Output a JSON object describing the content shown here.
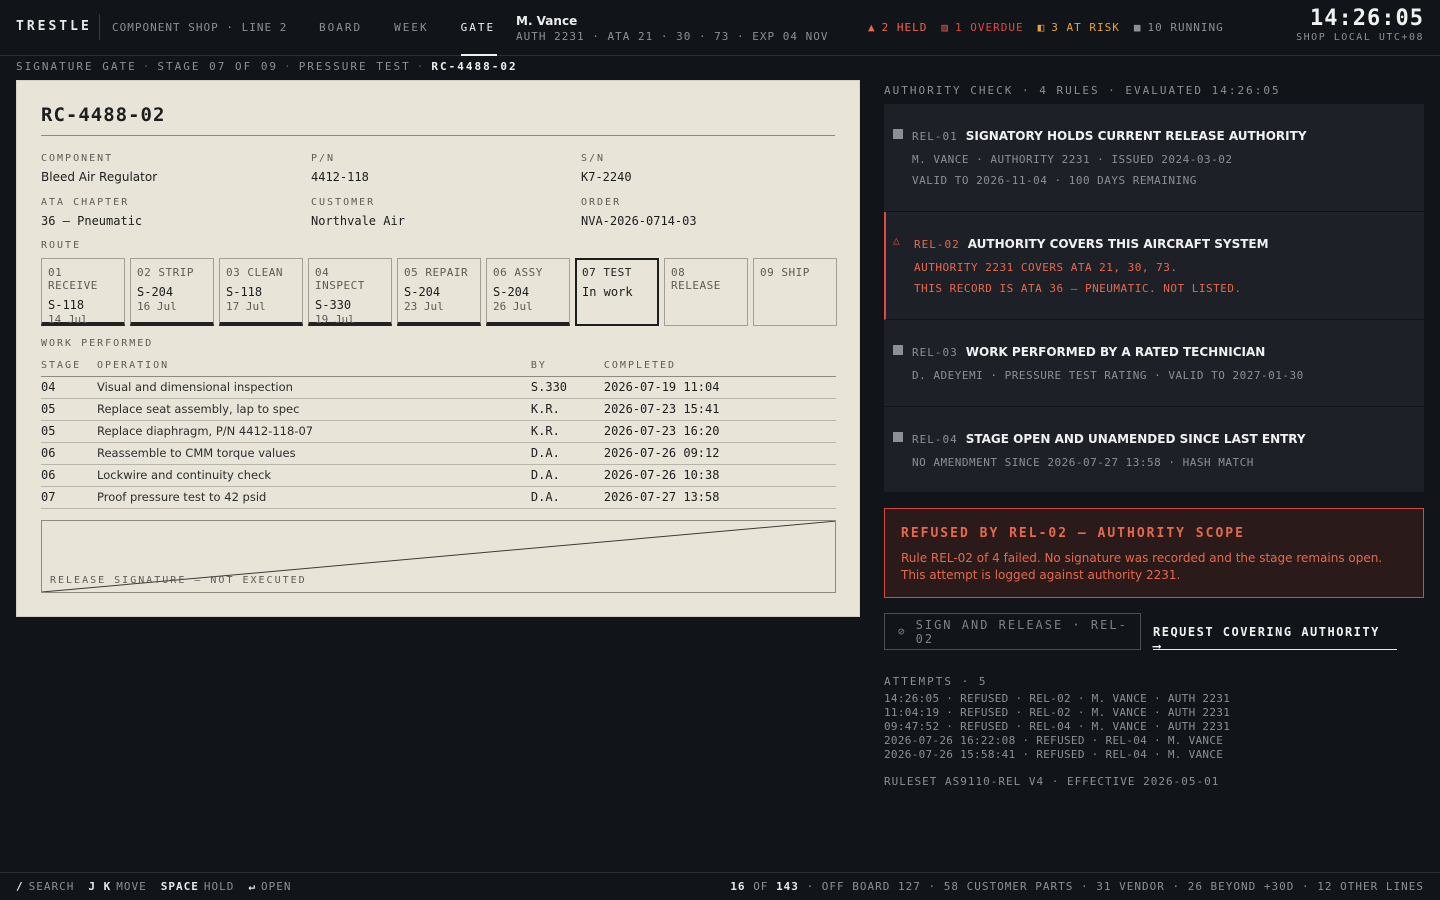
{
  "topbar": {
    "brand": "TRESTLE",
    "shopline": "COMPONENT SHOP · LINE 2",
    "tabs": [
      "BOARD",
      "WEEK",
      "GATE"
    ],
    "active_tab": "GATE",
    "user": {
      "name": "M. Vance",
      "auth": "AUTH 2231 · ATA 21 · 30 · 73 · EXP 04 NOV"
    },
    "stats": {
      "held": "2 HELD",
      "overdue": "1 OVERDUE",
      "risk": "3 AT RISK",
      "running": "10 RUNNING"
    },
    "clock": {
      "time": "14:26:05",
      "zone": "SHOP LOCAL UTC+08"
    }
  },
  "breadcrumb": {
    "items": [
      "SIGNATURE GATE",
      "STAGE 07 OF 09",
      "PRESSURE TEST"
    ],
    "current": "RC-4488-02"
  },
  "record": {
    "id": "RC-4488-02",
    "fields": {
      "component": {
        "label": "COMPONENT",
        "value": "Bleed Air Regulator"
      },
      "pn": {
        "label": "P/N",
        "value": "4412-118"
      },
      "sn": {
        "label": "S/N",
        "value": "K7-2240"
      },
      "ata": {
        "label": "ATA CHAPTER",
        "value": "36 — Pneumatic"
      },
      "customer": {
        "label": "CUSTOMER",
        "value": "Northvale Air"
      },
      "order": {
        "label": "ORDER",
        "value": "NVA-2026-0714-03"
      }
    },
    "route_label": "ROUTE",
    "route": [
      {
        "name": "01 RECEIVE",
        "val": "S-118",
        "date": "14 Jul"
      },
      {
        "name": "02 STRIP",
        "val": "S-204",
        "date": "16 Jul"
      },
      {
        "name": "03 CLEAN",
        "val": "S-118",
        "date": "17 Jul"
      },
      {
        "name": "04 INSPECT",
        "val": "S-330",
        "date": "19 Jul"
      },
      {
        "name": "05 REPAIR",
        "val": "S-204",
        "date": "23 Jul"
      },
      {
        "name": "06 ASSY",
        "val": "S-204",
        "date": "26 Jul"
      },
      {
        "name": "07 TEST",
        "val": "In work",
        "date": ""
      },
      {
        "name": "08 RELEASE",
        "val": "",
        "date": ""
      },
      {
        "name": "09 SHIP",
        "val": "",
        "date": ""
      }
    ],
    "work_label": "WORK PERFORMED",
    "work_headers": [
      "STAGE",
      "OPERATION",
      "BY",
      "COMPLETED"
    ],
    "work": [
      [
        "04",
        "Visual and dimensional inspection",
        "S.330",
        "2026-07-19 11:04"
      ],
      [
        "05",
        "Replace seat assembly, lap to spec",
        "K.R.",
        "2026-07-23 15:41"
      ],
      [
        "05",
        "Replace diaphragm, P/N 4412-118-07",
        "K.R.",
        "2026-07-23 16:20"
      ],
      [
        "06",
        "Reassemble to CMM torque values",
        "D.A.",
        "2026-07-26 09:12"
      ],
      [
        "06",
        "Lockwire and continuity check",
        "D.A.",
        "2026-07-26 10:38"
      ],
      [
        "07",
        "Proof pressure test to 42 psid",
        "D.A.",
        "2026-07-27 13:58"
      ]
    ],
    "signature": "RELEASE SIGNATURE — NOT EXECUTED"
  },
  "authority": {
    "header": "AUTHORITY CHECK · 4 RULES · EVALUATED 14:26:05",
    "rules": [
      {
        "id": "REL-01",
        "title": "SIGNATORY HOLDS CURRENT RELEASE AUTHORITY",
        "status": "pass",
        "lines": [
          "M. VANCE · AUTHORITY 2231 · ISSUED 2024-03-02",
          "VALID TO 2026-11-04 · 100 DAYS REMAINING"
        ]
      },
      {
        "id": "REL-02",
        "title": "AUTHORITY COVERS THIS AIRCRAFT SYSTEM",
        "status": "fail",
        "lines": [
          "AUTHORITY 2231 COVERS ATA 21, 30, 73.",
          "THIS RECORD IS ATA 36 — PNEUMATIC. NOT LISTED."
        ]
      },
      {
        "id": "REL-03",
        "title": "WORK PERFORMED BY A RATED TECHNICIAN",
        "status": "pass",
        "lines": [
          "D. ADEYEMI · PRESSURE TEST RATING · VALID TO 2027-01-30"
        ]
      },
      {
        "id": "REL-04",
        "title": "STAGE OPEN AND UNAMENDED SINCE LAST ENTRY",
        "status": "pass",
        "lines": [
          "NO AMENDMENT SINCE 2026-07-27 13:58 · HASH MATCH"
        ]
      }
    ],
    "refused_title": "REFUSED BY REL-02 — AUTHORITY SCOPE",
    "refused_body": "Rule REL-02 of 4 failed. No signature was recorded and the stage remains open. This attempt is logged against authority 2231.",
    "sign_button": "SIGN AND RELEASE · REL-02",
    "request_button": "REQUEST COVERING AUTHORITY ⟶",
    "attempts_header": "ATTEMPTS · 5",
    "attempts": [
      "14:26:05 · REFUSED · REL-02 · M. VANCE · AUTH 2231",
      "11:04:19 · REFUSED · REL-02 · M. VANCE · AUTH 2231",
      "09:47:52 · REFUSED · REL-04 · M. VANCE · AUTH 2231",
      "2026-07-26 16:22:08 · REFUSED · REL-04 · M. VANCE",
      "2026-07-26 15:58:41 · REFUSED · REL-04 · M. VANCE"
    ],
    "ruleset": "RULESET AS9110-REL V4 · EFFECTIVE 2026-05-01"
  },
  "footer": {
    "keys": [
      {
        "k": "/",
        "label": "SEARCH"
      },
      {
        "k": "J K",
        "label": "MOVE"
      },
      {
        "k": "SPACE",
        "label": "HOLD"
      },
      {
        "k": "↵",
        "label": "OPEN"
      }
    ],
    "position": "16",
    "position_of": "OF",
    "total": "143",
    "summary": "· OFF BOARD 127 · 58 CUSTOMER PARTS · 31 VENDOR · 26 BEYOND +30D · 12 OTHER LINES"
  },
  "colors": {
    "held": "#f0664c",
    "overdue": "#e14a43",
    "risk": "#e8a23a",
    "paper": "#e8e4d8",
    "bg": "#111418"
  },
  "icons": {
    "held": "warning-triangle-icon",
    "overdue": "overdue-icon",
    "risk": "risk-icon",
    "running": "running-square-icon",
    "sign": "blocked-icon"
  }
}
